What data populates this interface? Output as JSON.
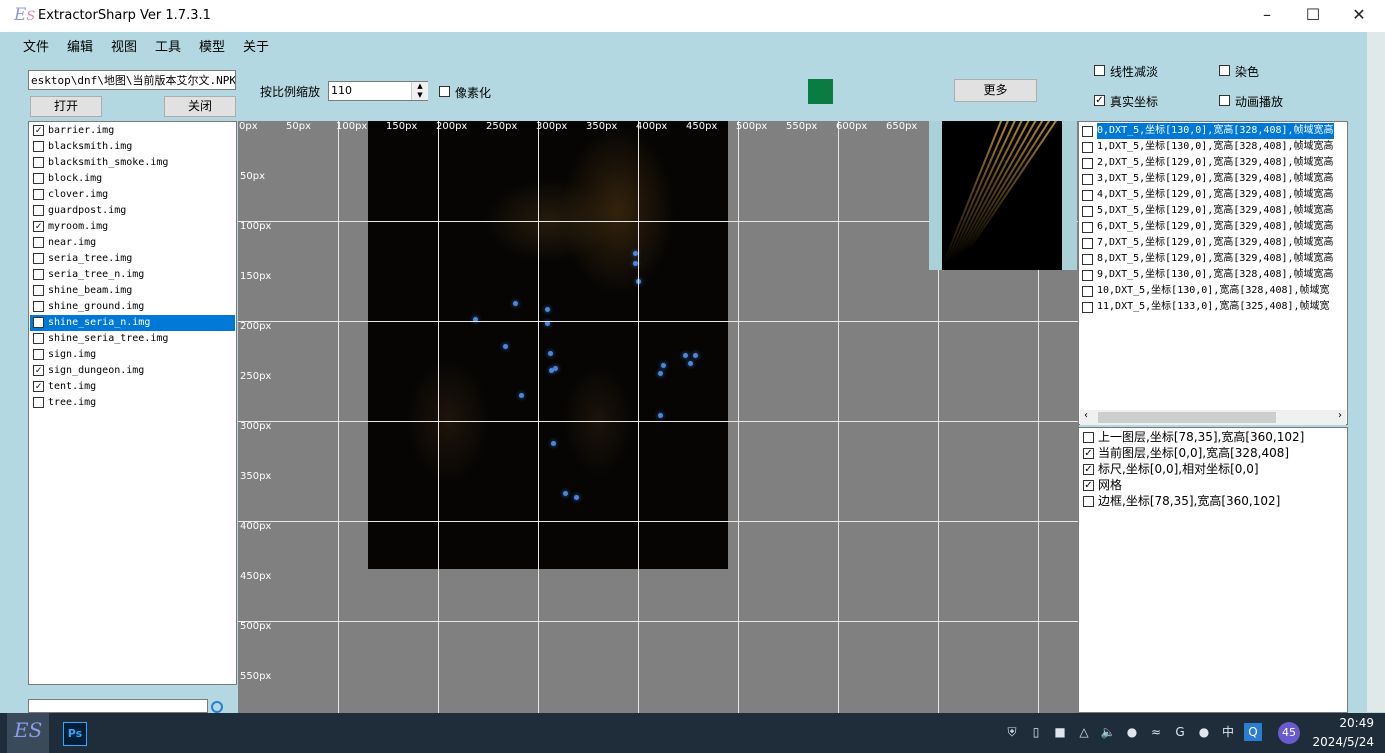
{
  "window": {
    "title": "ExtractorSharp Ver 1.7.3.1",
    "logo": "ES"
  },
  "menu": [
    "文件",
    "编辑",
    "视图",
    "工具",
    "模型",
    "关于"
  ],
  "file_panel": {
    "path": "esktop\\dnf\\地图\\当前版本艾尔文.NPK",
    "open_label": "打开",
    "close_label": "关闭",
    "files": [
      {
        "name": "barrier.img",
        "checked": true
      },
      {
        "name": "blacksmith.img",
        "checked": false
      },
      {
        "name": "blacksmith_smoke.img",
        "checked": false
      },
      {
        "name": "block.img",
        "checked": false
      },
      {
        "name": "clover.img",
        "checked": false
      },
      {
        "name": "guardpost.img",
        "checked": false
      },
      {
        "name": "myroom.img",
        "checked": true
      },
      {
        "name": "near.img",
        "checked": false
      },
      {
        "name": "seria_tree.img",
        "checked": false
      },
      {
        "name": "seria_tree_n.img",
        "checked": false
      },
      {
        "name": "shine_beam.img",
        "checked": false
      },
      {
        "name": "shine_ground.img",
        "checked": false
      },
      {
        "name": "shine_seria_n.img",
        "checked": false,
        "selected": true
      },
      {
        "name": "shine_seria_tree.img",
        "checked": false
      },
      {
        "name": "sign.img",
        "checked": false
      },
      {
        "name": "sign_dungeon.img",
        "checked": true
      },
      {
        "name": "tent.img",
        "checked": true
      },
      {
        "name": "tree.img",
        "checked": false
      }
    ]
  },
  "toolbar": {
    "scale_label": "按比例缩放",
    "scale_value": "110",
    "pixelize_label": "像素化",
    "more_label": "更多",
    "swatch_color": "#0a7c42"
  },
  "options": {
    "linear_fade": {
      "label": "线性减淡",
      "checked": false
    },
    "dye": {
      "label": "染色",
      "checked": false
    },
    "real_coords": {
      "label": "真实坐标",
      "checked": true
    },
    "animation": {
      "label": "动画播放",
      "checked": false
    }
  },
  "ruler": {
    "x_labels": [
      "0px",
      "50px",
      "100px",
      "150px",
      "200px",
      "250px",
      "300px",
      "350px",
      "400px",
      "450px",
      "500px",
      "550px",
      "600px",
      "650px"
    ],
    "y_labels": [
      "50px",
      "100px",
      "150px",
      "200px",
      "250px",
      "300px",
      "350px",
      "400px",
      "450px",
      "500px",
      "550px"
    ]
  },
  "frames": [
    {
      "text": "0,DXT_5,坐标[130,0],宽高[328,408],帧域宽高",
      "checked": false,
      "selected": true
    },
    {
      "text": "1,DXT_5,坐标[130,0],宽高[328,408],帧域宽高",
      "checked": false
    },
    {
      "text": "2,DXT_5,坐标[129,0],宽高[329,408],帧域宽高",
      "checked": false
    },
    {
      "text": "3,DXT_5,坐标[129,0],宽高[329,408],帧域宽高",
      "checked": false
    },
    {
      "text": "4,DXT_5,坐标[129,0],宽高[329,408],帧域宽高",
      "checked": false
    },
    {
      "text": "5,DXT_5,坐标[129,0],宽高[329,408],帧域宽高",
      "checked": false
    },
    {
      "text": "6,DXT_5,坐标[129,0],宽高[329,408],帧域宽高",
      "checked": false
    },
    {
      "text": "7,DXT_5,坐标[129,0],宽高[329,408],帧域宽高",
      "checked": false
    },
    {
      "text": "8,DXT_5,坐标[129,0],宽高[329,408],帧域宽高",
      "checked": false
    },
    {
      "text": "9,DXT_5,坐标[130,0],宽高[328,408],帧域宽高",
      "checked": false
    },
    {
      "text": "10,DXT_5,坐标[130,0],宽高[328,408],帧域宽",
      "checked": false
    },
    {
      "text": "11,DXT_5,坐标[133,0],宽高[325,408],帧域宽",
      "checked": false
    }
  ],
  "layers": [
    {
      "text": "上一图层,坐标[78,35],宽高[360,102]",
      "checked": false
    },
    {
      "text": "当前图层,坐标[0,0],宽高[328,408]",
      "checked": true
    },
    {
      "text": "标尺,坐标[0,0],相对坐标[0,0]",
      "checked": true
    },
    {
      "text": "网格",
      "checked": true
    },
    {
      "text": "边框,坐标[78,35],宽高[360,102]",
      "checked": false
    }
  ],
  "taskbar": {
    "time": "20:49",
    "date": "2024/5/24",
    "badge": "45",
    "ime": "中"
  }
}
